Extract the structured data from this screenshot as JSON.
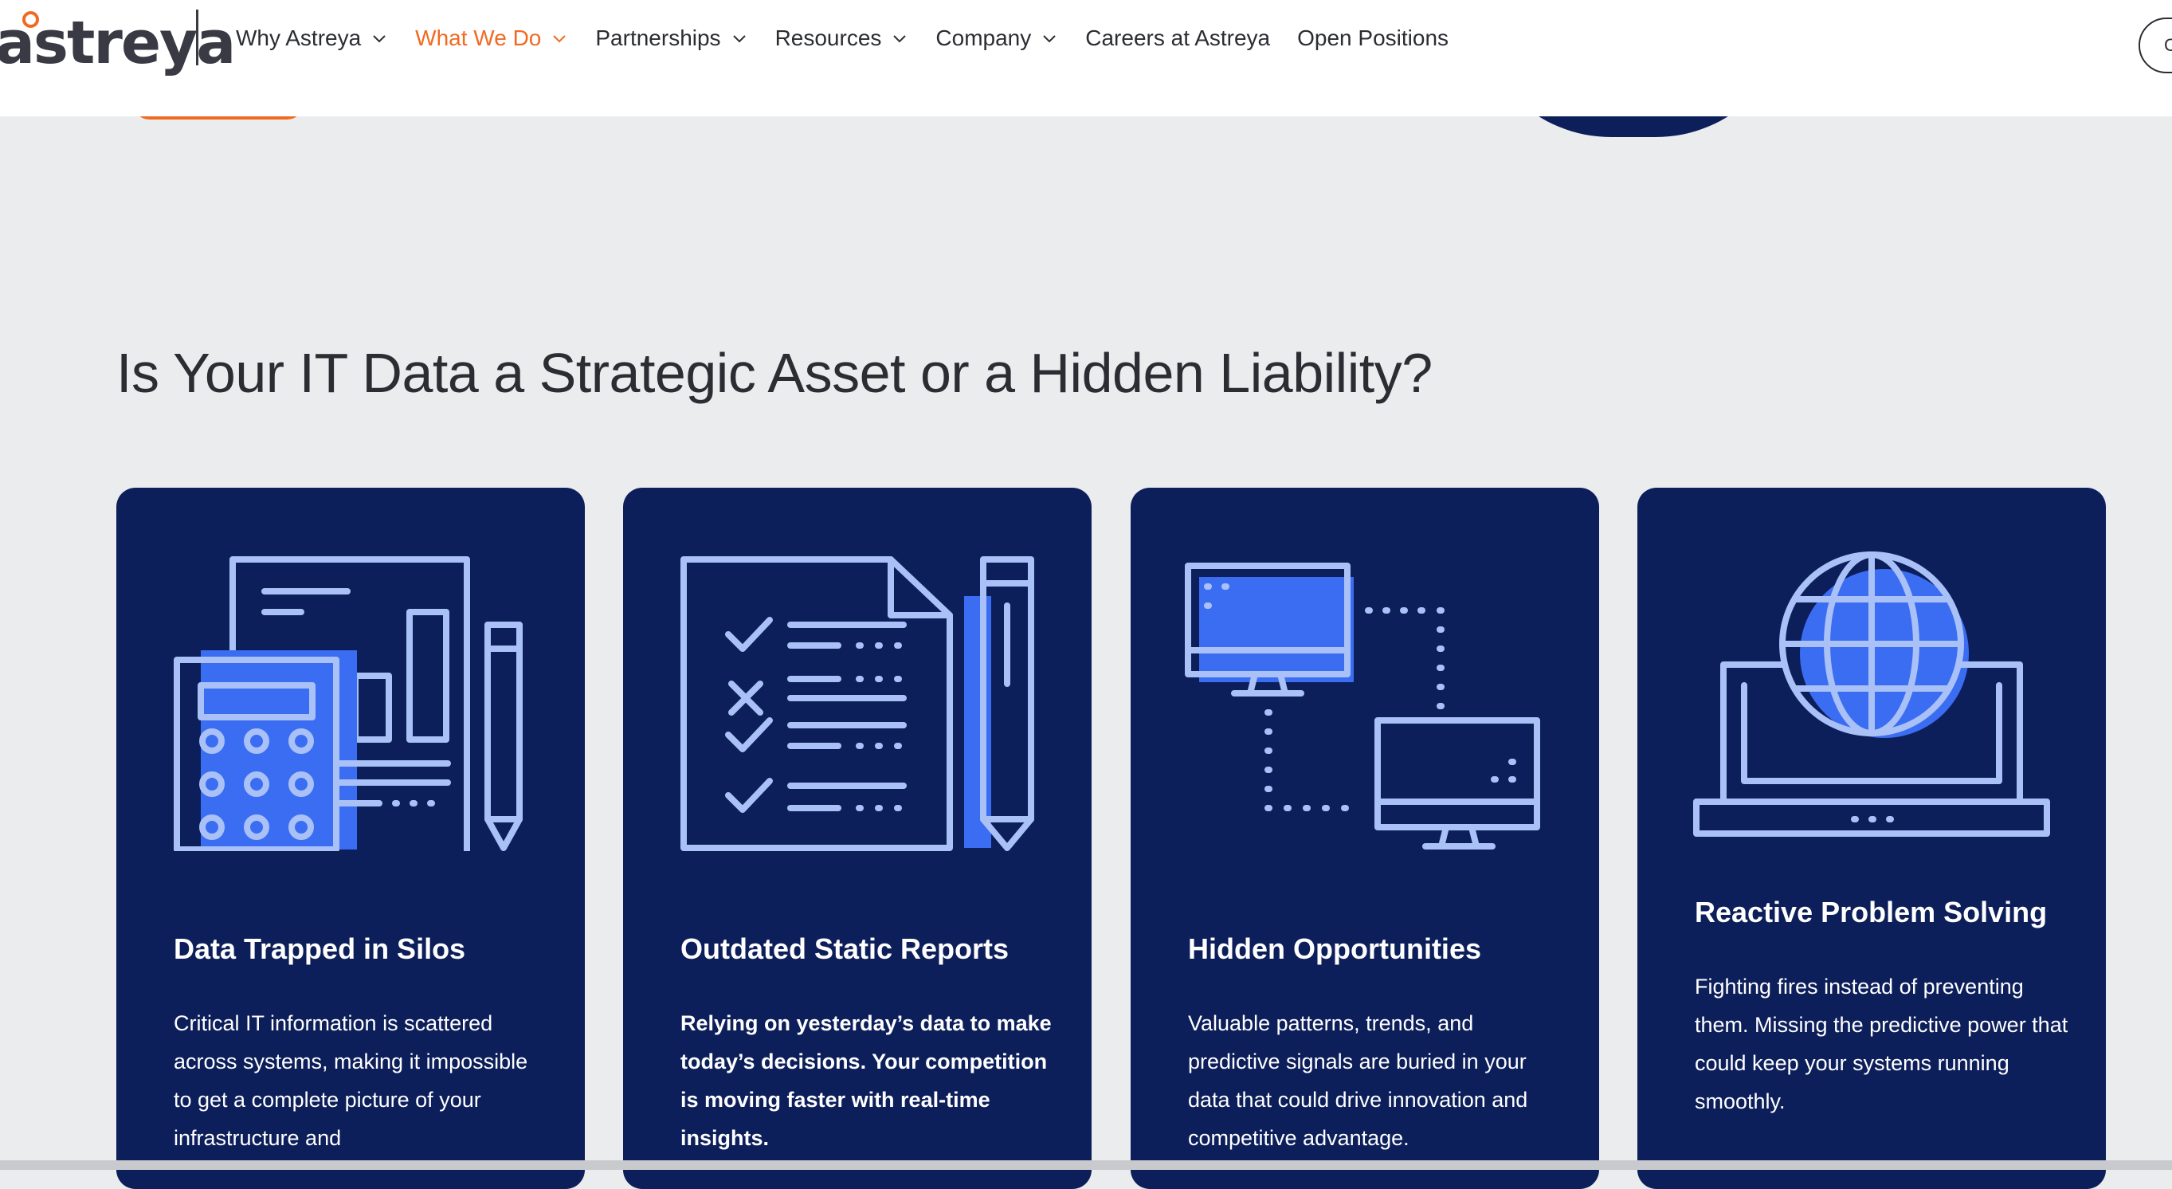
{
  "header": {
    "logo_text": "astreya",
    "nav": [
      {
        "label": "Why Astreya",
        "has_dropdown": true,
        "active": false
      },
      {
        "label": "What We Do",
        "has_dropdown": true,
        "active": true
      },
      {
        "label": "Partnerships",
        "has_dropdown": true,
        "active": false
      },
      {
        "label": "Resources",
        "has_dropdown": true,
        "active": false
      },
      {
        "label": "Company",
        "has_dropdown": true,
        "active": false
      },
      {
        "label": "Careers at Astreya",
        "has_dropdown": false,
        "active": false
      },
      {
        "label": "Open Positions",
        "has_dropdown": false,
        "active": false
      }
    ],
    "cta_label": "C"
  },
  "section": {
    "title": "Is Your IT Data a Strategic Asset or a Hidden Liability?",
    "cards": [
      {
        "icon": "calculator-report-icon",
        "title": "Data Trapped in Silos",
        "description": "Critical IT information is scattered across systems, making it impossible to get a complete picture of your infrastructure and"
      },
      {
        "icon": "checklist-document-icon",
        "title": "Outdated Static Reports",
        "description": "Relying on yesterday’s data to make today’s decisions. Your competition is moving faster with real-time insights."
      },
      {
        "icon": "connected-monitors-icon",
        "title": "Hidden Opportunities",
        "description": "Valuable patterns, trends, and predictive signals are buried in your data that could drive innovation and competitive advantage."
      },
      {
        "icon": "laptop-globe-icon",
        "title": "Reactive Problem Solving",
        "description": "Fighting fires instead of preventing them. Missing the predictive power that could keep your systems running smoothly."
      }
    ]
  },
  "colors": {
    "accent": "#f26a21",
    "card_bg": "#0d1f5a",
    "icon_light": "#a9c1f7",
    "icon_blue": "#3b6df2",
    "page_bg": "#ebecee"
  }
}
